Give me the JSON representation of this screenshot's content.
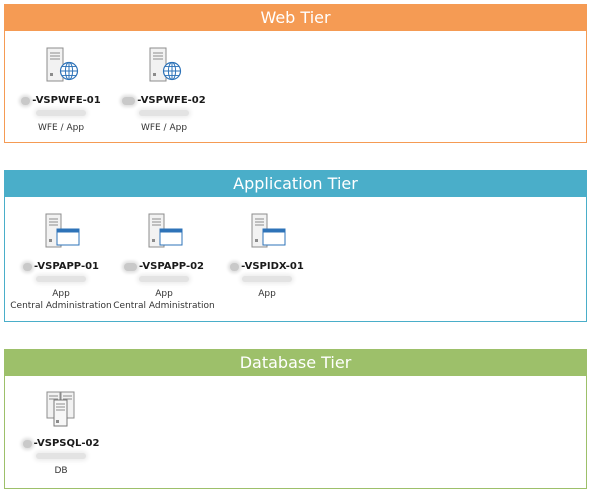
{
  "tiers": {
    "web": {
      "title": "Web Tier",
      "servers": [
        {
          "name": "-VSPWFE-01",
          "role": "WFE / App",
          "role2": ""
        },
        {
          "name": "-VSPWFE-02",
          "role": "WFE / App",
          "role2": ""
        }
      ]
    },
    "app": {
      "title": "Application Tier",
      "servers": [
        {
          "name": "-VSPAPP-01",
          "role": "App",
          "role2": "Central Administration"
        },
        {
          "name": "-VSPAPP-02",
          "role": "App",
          "role2": "Central Administration"
        },
        {
          "name": "-VSPIDX-01",
          "role": "App",
          "role2": ""
        }
      ]
    },
    "db": {
      "title": "Database Tier",
      "servers": [
        {
          "name": "-VSPSQL-02",
          "role": "DB",
          "role2": ""
        }
      ]
    }
  },
  "icons": {
    "web_server": "web-server-globe-icon",
    "app_server": "application-server-window-icon",
    "db_server": "database-server-cluster-icon"
  },
  "colors": {
    "web_tier": "#f59b54",
    "app_tier": "#4aaec9",
    "db_tier": "#9dc06a",
    "globe": "#2e73b8"
  }
}
